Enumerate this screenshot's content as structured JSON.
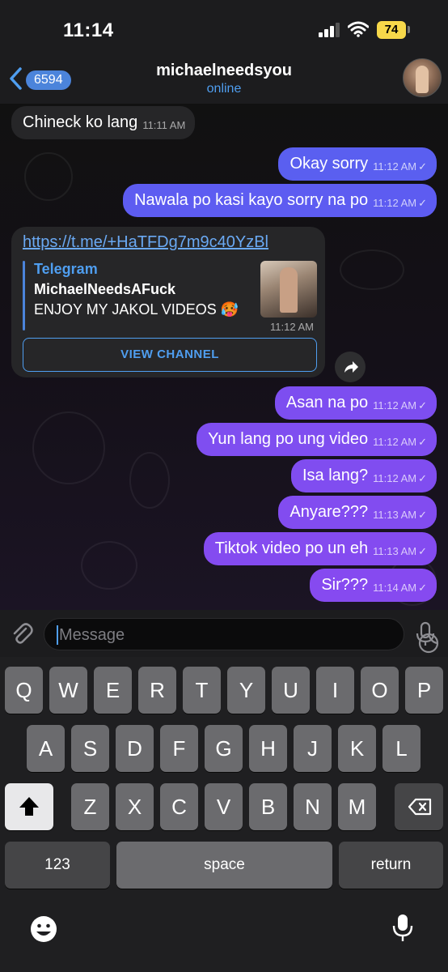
{
  "status_bar": {
    "time": "11:14",
    "battery": "74"
  },
  "header": {
    "back_count": "6594",
    "title": "michaelneedsyou",
    "status": "online"
  },
  "messages": [
    {
      "dir": "in",
      "text": "Chineck ko lang",
      "time": "11:11 AM"
    },
    {
      "dir": "out",
      "text": "Okay sorry",
      "time": "11:12 AM",
      "color": "#5a5ff0"
    },
    {
      "dir": "out",
      "text": "Nawala po kasi kayo sorry na po",
      "time": "11:12 AM",
      "color": "#5d5cf1"
    },
    {
      "dir": "out",
      "text": "Asan na po",
      "time": "11:12 AM",
      "color": "#7d4ef0"
    },
    {
      "dir": "out",
      "text": "Yun lang po ung video",
      "time": "11:12 AM",
      "color": "#7f4ef0"
    },
    {
      "dir": "out",
      "text": "Isa lang?",
      "time": "11:12 AM",
      "color": "#804df0"
    },
    {
      "dir": "out",
      "text": "Anyare???",
      "time": "11:13 AM",
      "color": "#824cf0"
    },
    {
      "dir": "out",
      "text": "Tiktok video po un eh",
      "time": "11:13 AM",
      "color": "#844bf0"
    },
    {
      "dir": "out",
      "text": "Sir???",
      "time": "11:14 AM",
      "color": "#864af0"
    }
  ],
  "link_message": {
    "url": "https://t.me/+HaTFDg7m9c40YzBl",
    "site": "Telegram",
    "title": "MichaelNeedsAFuck",
    "description": "ENJOY MY JAKOL VIDEOS 🥵",
    "time": "11:12 AM",
    "button": "VIEW CHANNEL"
  },
  "input": {
    "placeholder": "Message"
  },
  "keyboard": {
    "row1": [
      "Q",
      "W",
      "E",
      "R",
      "T",
      "Y",
      "U",
      "I",
      "O",
      "P"
    ],
    "row2": [
      "A",
      "S",
      "D",
      "F",
      "G",
      "H",
      "J",
      "K",
      "L"
    ],
    "row3": [
      "Z",
      "X",
      "C",
      "V",
      "B",
      "N",
      "M"
    ],
    "numbers": "123",
    "space": "space",
    "return": "return"
  },
  "colors": {
    "accent": "#4f9ef0",
    "incoming": "#262628",
    "battery": "#f7d84a"
  }
}
